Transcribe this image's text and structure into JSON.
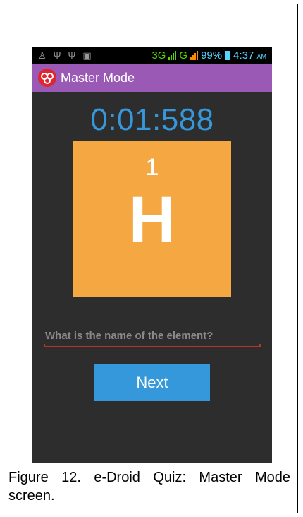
{
  "status_bar": {
    "network": "3G",
    "network2": "G",
    "battery": "99%",
    "time": "4:37",
    "ampm": "AM",
    "icons": [
      "android-icon",
      "usb-icon",
      "usb-icon",
      "image-icon"
    ]
  },
  "app_bar": {
    "title": "Master Mode"
  },
  "quiz": {
    "timer": "0:01:588",
    "atomic_number": "1",
    "symbol": "H",
    "answer_placeholder": "What is the name of the element?",
    "answer_value": "",
    "next_label": "Next"
  },
  "caption": "Figure 12. e-Droid Quiz: Master Mode screen.",
  "colors": {
    "app_bar": "#9b59b6",
    "accent": "#3498db",
    "tile": "#f5a742",
    "background": "#2d2d2d"
  }
}
